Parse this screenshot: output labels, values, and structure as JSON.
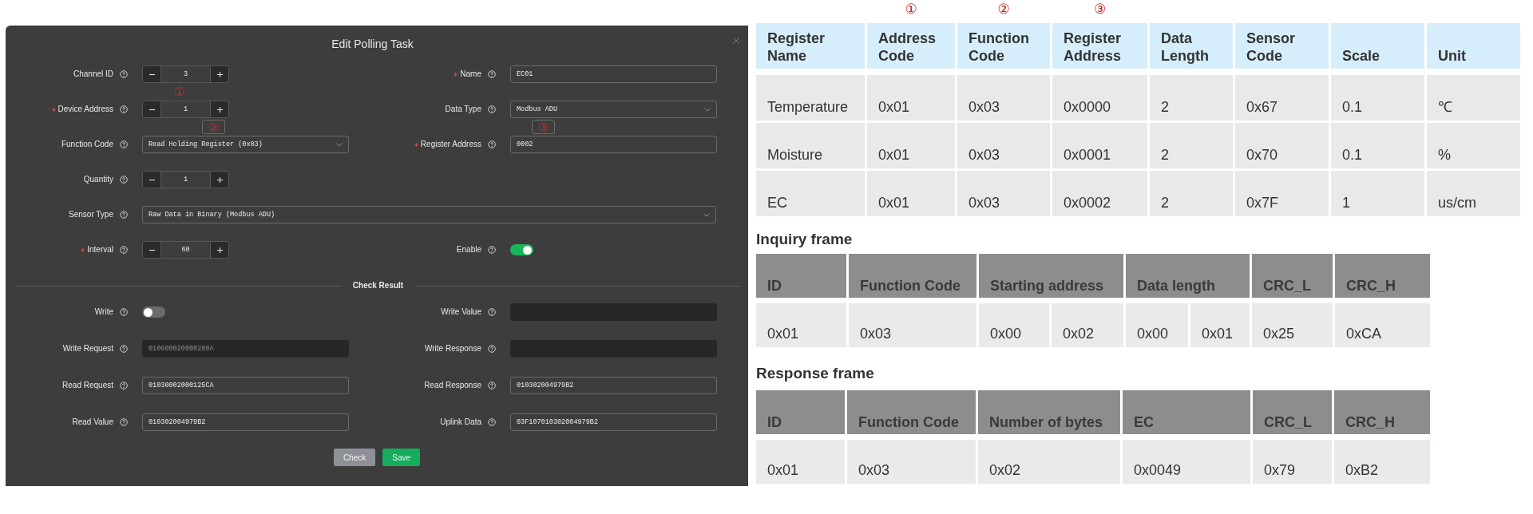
{
  "dialog": {
    "title": "Edit Polling Task",
    "rows": [
      [
        {
          "kind": "stepper",
          "label": "Channel ID",
          "required": false,
          "value": "3"
        },
        {
          "kind": "text",
          "label": "Name",
          "required": true,
          "value": "EC01",
          "disabled": false
        }
      ],
      [
        {
          "kind": "stepper",
          "label": "Device Address",
          "required": true,
          "value": "1",
          "annotation": "①"
        },
        {
          "kind": "select",
          "label": "Data Type",
          "required": false,
          "value": "Modbus ADU"
        }
      ],
      [
        {
          "kind": "select",
          "label": "Function Code",
          "required": false,
          "value": "Read Holding Register (0x03)",
          "annotation": "②"
        },
        {
          "kind": "text",
          "label": "Register Address",
          "required": true,
          "value": "0002",
          "disabled": false,
          "annotation": "③"
        }
      ],
      [
        {
          "kind": "stepper",
          "label": "Quantity",
          "required": false,
          "value": "1"
        }
      ],
      [
        {
          "kind": "select",
          "label": "Sensor Type",
          "required": false,
          "value": "Raw Data in Binary (Modbus ADU)"
        }
      ],
      [
        {
          "kind": "stepper",
          "label": "Interval",
          "required": true,
          "value": "60"
        },
        {
          "kind": "toggle",
          "label": "Enable",
          "required": false,
          "on": true
        }
      ]
    ],
    "section_title": "Check Result",
    "result_rows": [
      [
        {
          "kind": "toggle",
          "label": "Write",
          "required": false,
          "on": false
        },
        {
          "kind": "text",
          "label": "Write Value",
          "required": false,
          "disabled": true
        }
      ],
      [
        {
          "kind": "text",
          "label": "Write Request",
          "required": false,
          "value": "010600020000280A",
          "disabled": true
        },
        {
          "kind": "text",
          "label": "Write Response",
          "required": false,
          "disabled": true
        }
      ],
      [
        {
          "kind": "text",
          "label": "Read Request",
          "required": false,
          "value": "01030002000125CA",
          "disabled": false
        },
        {
          "kind": "text",
          "label": "Read Response",
          "required": false,
          "value": "010302004979B2",
          "disabled": false
        }
      ],
      [
        {
          "kind": "text",
          "label": "Read Value",
          "required": false,
          "value": "010302004979B2",
          "disabled": false
        },
        {
          "kind": "text",
          "label": "Uplink Data",
          "required": false,
          "value": "03F107010302004979B2",
          "disabled": false
        }
      ]
    ],
    "buttons": [
      {
        "label": "Check",
        "kind": "secondary"
      },
      {
        "label": "Save",
        "kind": "primary"
      }
    ]
  },
  "register_table": {
    "columns": [
      {
        "label": "Register Name"
      },
      {
        "label": "Address Code",
        "annotation": "①"
      },
      {
        "label": "Function Code",
        "annotation": "②"
      },
      {
        "label": "Register Address",
        "annotation": "③"
      },
      {
        "label": "Data Length"
      },
      {
        "label": "Sensor Code"
      },
      {
        "label": "Scale"
      },
      {
        "label": "Unit"
      }
    ],
    "rows": [
      [
        "Temperature",
        "0x01",
        "0x03",
        "0x0000",
        "2",
        "0x67",
        "0.1",
        "℃"
      ],
      [
        "Moisture",
        "0x01",
        "0x03",
        "0x0001",
        "2",
        "0x70",
        "0.1",
        "%"
      ],
      [
        "EC",
        "0x01",
        "0x03",
        "0x0002",
        "2",
        "0x7F",
        "1",
        "us/cm"
      ]
    ]
  },
  "inquiry_frame": {
    "title": "Inquiry frame",
    "columns": [
      {
        "label": "ID",
        "cells": [
          "0x01"
        ]
      },
      {
        "label": "Function Code",
        "cells": [
          "0x03"
        ]
      },
      {
        "label": "Starting address",
        "cells": [
          "0x00",
          "0x02"
        ]
      },
      {
        "label": "Data length",
        "cells": [
          "0x00",
          "0x01"
        ]
      },
      {
        "label": "CRC_L",
        "cells": [
          "0x25"
        ]
      },
      {
        "label": "CRC_H",
        "cells": [
          "0xCA"
        ]
      }
    ]
  },
  "response_frame": {
    "title": "Response frame",
    "columns": [
      {
        "label": "ID",
        "cells": [
          "0x01"
        ]
      },
      {
        "label": "Function Code",
        "cells": [
          "0x03"
        ]
      },
      {
        "label": "Number of bytes",
        "cells": [
          "0x02"
        ]
      },
      {
        "label": "EC",
        "cells": [
          "0x0049"
        ]
      },
      {
        "label": "CRC_L",
        "cells": [
          "0x79"
        ]
      },
      {
        "label": "CRC_H",
        "cells": [
          "0xB2"
        ]
      }
    ]
  }
}
